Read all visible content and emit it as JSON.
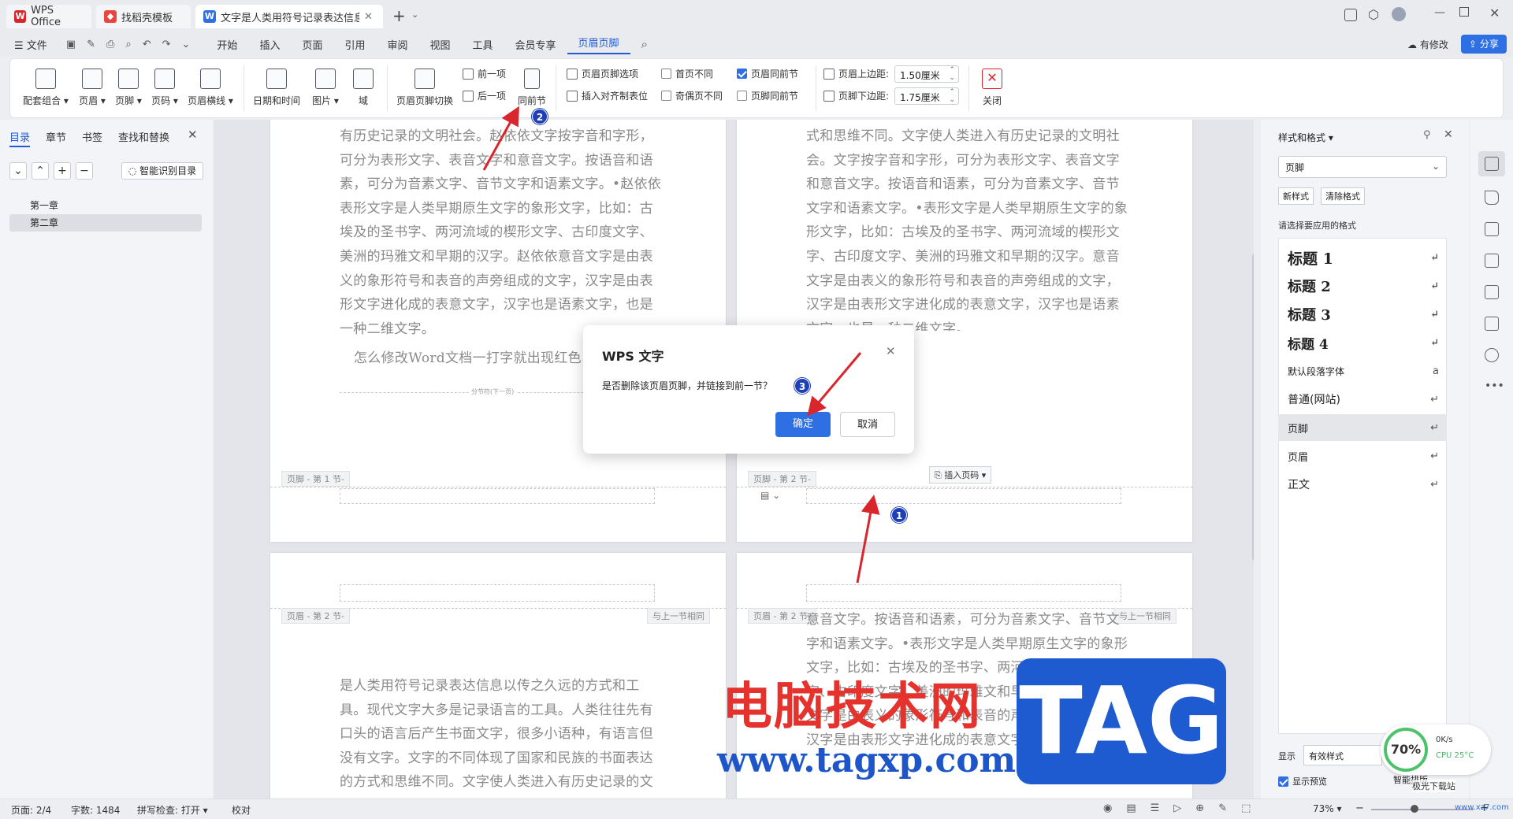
{
  "titlebar": {
    "tabs": [
      {
        "label": "WPS Office"
      },
      {
        "label": "找稻壳模板"
      },
      {
        "label": "文字是人类用符号记录表达信息以"
      }
    ],
    "new_tab": "+"
  },
  "menubar": {
    "file": "文件",
    "items": [
      "开始",
      "插入",
      "页面",
      "引用",
      "审阅",
      "视图",
      "工具",
      "会员专享",
      "页眉页脚"
    ],
    "modified": "有修改",
    "share": "分享"
  },
  "ribbon": {
    "big": [
      "配套组合",
      "页眉",
      "页脚",
      "页码",
      "页眉横线",
      "日期和时间",
      "图片",
      "域",
      "页眉页脚切换"
    ],
    "nav_prev": "前一项",
    "nav_next": "后一项",
    "same_prev": "同前节",
    "options": "页眉页脚选项",
    "align_tab": "插入对齐制表位",
    "first_diff": "首页不同",
    "odd_even_diff": "奇偶页不同",
    "header_same": "页眉同前节",
    "footer_same": "页脚同前节",
    "top_margin_label": "页眉上边距:",
    "top_margin_value": "1.50厘米",
    "bottom_margin_label": "页脚下边距:",
    "bottom_margin_value": "1.75厘米",
    "close": "关闭"
  },
  "leftpanel": {
    "tabs": [
      "目录",
      "章节",
      "书签",
      "查找和替换"
    ],
    "smart_toc": "智能识别目录",
    "items": [
      "第一章",
      "第二章"
    ]
  },
  "document": {
    "p1_text": "有历史记录的文明社会。赵依依文字按字音和字形，可分为表形文字、表音文字和意音文字。按语音和语素，可分为音素文字、音节文字和语素文字。•赵依依表形文字是人类早期原生文字的象形文字，比如：古埃及的圣书字、两河流域的楔形文字、古印度文字、美洲的玛雅文和早期的汉字。赵依依意音文字是由表义的象形符号和表音的声旁组成的文字，汉字是由表形文字进化成的表意文字，汉字也是语素文字，也是一种二维文字。",
    "p1_heading": "怎么修改Word文档一打字就出现红色",
    "p1_break": "分节符(下一页)",
    "p2_text": "式和思维不同。文字使人类进入有历史记录的文明社会。文字按字音和字形，可分为表形文字、表音文字和意音文字。按语音和语素，可分为音素文字、音节文字和语素文字。•表形文字是人类早期原生文字的象形文字，比如：古埃及的圣书字、两河流域的楔形文字、古印度文字、美洲的玛雅文和早期的汉字。意音文字是由表义的象形符号和表音的声旁组成的文字，汉字是由表形文字进化成的表意文字，汉字也是语素文字，也是一种二维文字。",
    "footer1_tag": "页脚 - 第 1 节-",
    "footer2_tag": "页脚 - 第 2 节-",
    "insert_pagenum": "插入页码",
    "header2_tag": "页眉 - 第 2 节-",
    "same_as_prev": "与上一节相同",
    "p3_text": "是人类用符号记录表达信息以传之久远的方式和工具。现代文字大多是记录语言的工具。人类往往先有口头的语言后产生书面文字，很多小语种，有语言但没有文字。文字的不同体现了国家和民族的书面表达的方式和思维不同。文字使人类进入有历史记录的文明社",
    "p4_text": "意音文字。按语音和语素，可分为音素文字、音节文字和语素文字。•表形文字是人类早期原生文字的象形文字，比如：古埃及的圣书字、两河流域的楔形文字、古印度文字、美洲的玛雅文和早期的汉字。意音文字是由表义的象形符号和表音的声旁组成的文字，汉字是由表形文字进化成的表意文字"
  },
  "dialog": {
    "title": "WPS 文字",
    "message": "是否删除该页眉页脚，并链接到前一节？",
    "ok": "确定",
    "cancel": "取消"
  },
  "badges": [
    "1",
    "2",
    "3"
  ],
  "rightpanel": {
    "title": "样式和格式",
    "current": "页脚",
    "new_style": "新样式",
    "clear_format": "清除格式",
    "prompt": "请选择要应用的格式",
    "styles": [
      "标题  1",
      "标题  2",
      "标题  3",
      "标题  4",
      "默认段落字体",
      "普通(网站)",
      "页脚",
      "页眉",
      "正文"
    ],
    "show_label": "显示",
    "show_value": "有效样式",
    "preview": "显示预览",
    "smart": "智能排版"
  },
  "perf": {
    "percent": "70%",
    "net": "0K/s",
    "cpu": "CPU 25°C"
  },
  "watermark": {
    "cn": "电脑技术网",
    "url": "www.tagxp.com",
    "tag": "TAG",
    "corner": "极光下载站",
    "corner_url": "www.xz7.com"
  },
  "statusbar": {
    "page": "页面: 2/4",
    "words": "字数: 1484",
    "spell": "拼写检查: 打开",
    "proof": "校对",
    "zoom": "73%"
  },
  "colors": {
    "accent": "#1f5ad6",
    "primary_button": "#2f6fe4",
    "annotation": "#d9262c",
    "badge": "#1f3fb8"
  }
}
